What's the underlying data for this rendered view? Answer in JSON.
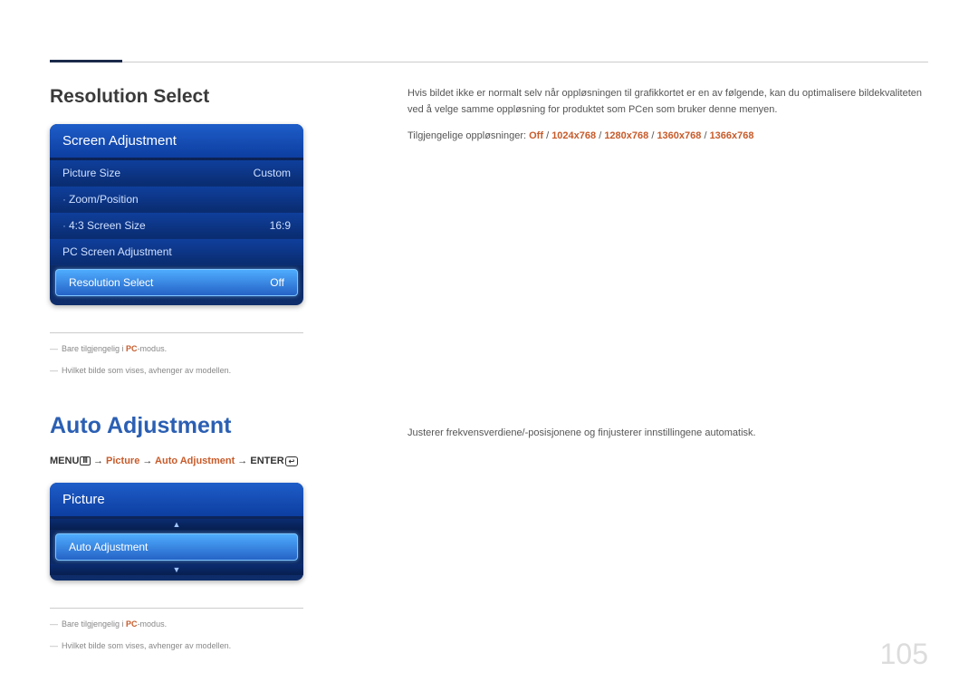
{
  "page_number": "105",
  "section1": {
    "title": "Resolution Select",
    "osd": {
      "header": "Screen Adjustment",
      "rows": [
        {
          "label": "Picture Size",
          "value": "Custom",
          "bullet": false,
          "selected": false
        },
        {
          "label": "Zoom/Position",
          "value": "",
          "bullet": true,
          "selected": false
        },
        {
          "label": "4:3 Screen Size",
          "value": "16:9",
          "bullet": true,
          "selected": false
        },
        {
          "label": "PC Screen Adjustment",
          "value": "",
          "bullet": false,
          "selected": false
        },
        {
          "label": "Resolution Select",
          "value": "Off",
          "bullet": false,
          "selected": true
        }
      ]
    },
    "note1_prefix": "Bare tilgjengelig i ",
    "note1_highlight": "PC",
    "note1_suffix": "-modus.",
    "note2": "Hvilket bilde som vises, avhenger av modellen.",
    "body_para": "Hvis bildet ikke er normalt selv når oppløsningen til grafikkortet er en av følgende, kan du optimalisere bildekvaliteten ved å velge samme oppløsning for produktet som PCen som bruker denne menyen.",
    "body_res_prefix": "Tilgjengelige oppløsninger: ",
    "body_res_sep": " / ",
    "body_res": [
      "Off",
      "1024x768",
      "1280x768",
      "1360x768",
      "1366x768"
    ]
  },
  "section2": {
    "title": "Auto Adjustment",
    "path": {
      "menu": "MENU",
      "arrow": " → ",
      "picture": "Picture",
      "auto": "Auto Adjustment",
      "enter": "ENTER"
    },
    "osd": {
      "header": "Picture",
      "row": "Auto Adjustment"
    },
    "note1_prefix": "Bare tilgjengelig i ",
    "note1_highlight": "PC",
    "note1_suffix": "-modus.",
    "note2": "Hvilket bilde som vises, avhenger av modellen.",
    "body_para": "Justerer frekvensverdiene/-posisjonene og finjusterer innstillingene automatisk."
  }
}
